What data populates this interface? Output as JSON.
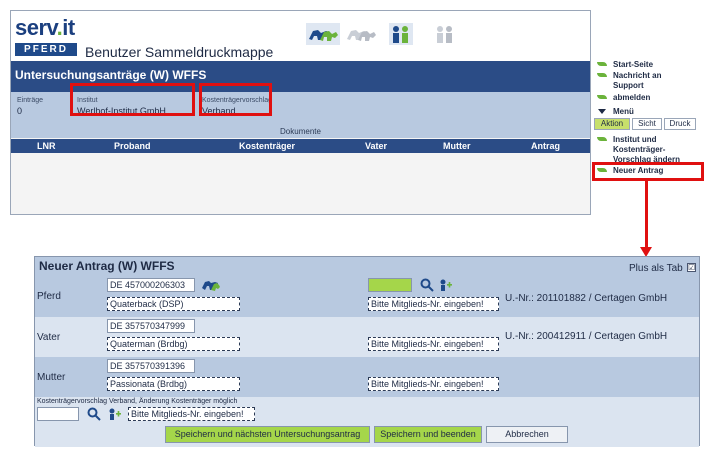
{
  "app": {
    "logo_word": "serv",
    "logo_dot": ".",
    "logo_word2": "it",
    "logo_sub": "PFERD",
    "title": "Benutzer Sammeldruckmappe"
  },
  "bar": {
    "title": "Untersuchungsanträge (W) WFFS"
  },
  "info": {
    "eintraege_label": "Einträge",
    "eintraege_value": "0",
    "institut_label": "Institut",
    "institut_value": "Werlhof-Institut GmbH",
    "kosten_label": "Kostenträgervorschlag",
    "kosten_value": "Verband"
  },
  "docs_label": "Dokumente",
  "columns": [
    "LNR",
    "Proband",
    "Kostenträger",
    "Vater",
    "Mutter",
    "Antrag"
  ],
  "side": {
    "items": [
      "Start-Seite",
      "Nachricht an Support",
      "abmelden"
    ],
    "menu_label": "Menü",
    "tabs": [
      "Aktion",
      "Sicht",
      "Druck"
    ],
    "actions": [
      "Institut und Kostenträger-Vorschlag ändern",
      "Neuer Antrag"
    ]
  },
  "dialog": {
    "title": "Neuer Antrag (W) WFFS",
    "plus_tab_label": "Plus als Tab",
    "plus_tab_check": "☑",
    "rows": [
      {
        "label": "Pferd",
        "id": "DE 457000206303",
        "name": "Quaterback (DSP)",
        "member_placeholder": "Bitte Mitglieds-Nr. eingeben!",
        "unr": "U.-Nr.: 201101882 / Certagen GmbH"
      },
      {
        "label": "Vater",
        "id": "DE 357570347999",
        "name": "Quaterman (Brdbg)",
        "member_placeholder": "Bitte Mitglieds-Nr. eingeben!",
        "unr": "U.-Nr.: 200412911 / Certagen GmbH"
      },
      {
        "label": "Mutter",
        "id": "DE 357570391396",
        "name": "Passionata (Brdbg)",
        "member_placeholder": "Bitte Mitglieds-Nr. eingeben!",
        "unr": ""
      }
    ],
    "kosten_note": "Kostenträgervorschlag Verband, Änderung Kostenträger möglich",
    "kosten_placeholder": "Bitte Mitglieds-Nr. eingeben!",
    "buttons": {
      "save_next": "Speichern und nächsten Untersuchungsantrag",
      "save_close": "Speichern und beenden",
      "cancel": "Abbrechen"
    }
  },
  "colors": {
    "bar": "#2b4c86",
    "panel": "#b8c9e0",
    "accent_green": "#a5d64a",
    "highlight_red": "#e01010"
  }
}
